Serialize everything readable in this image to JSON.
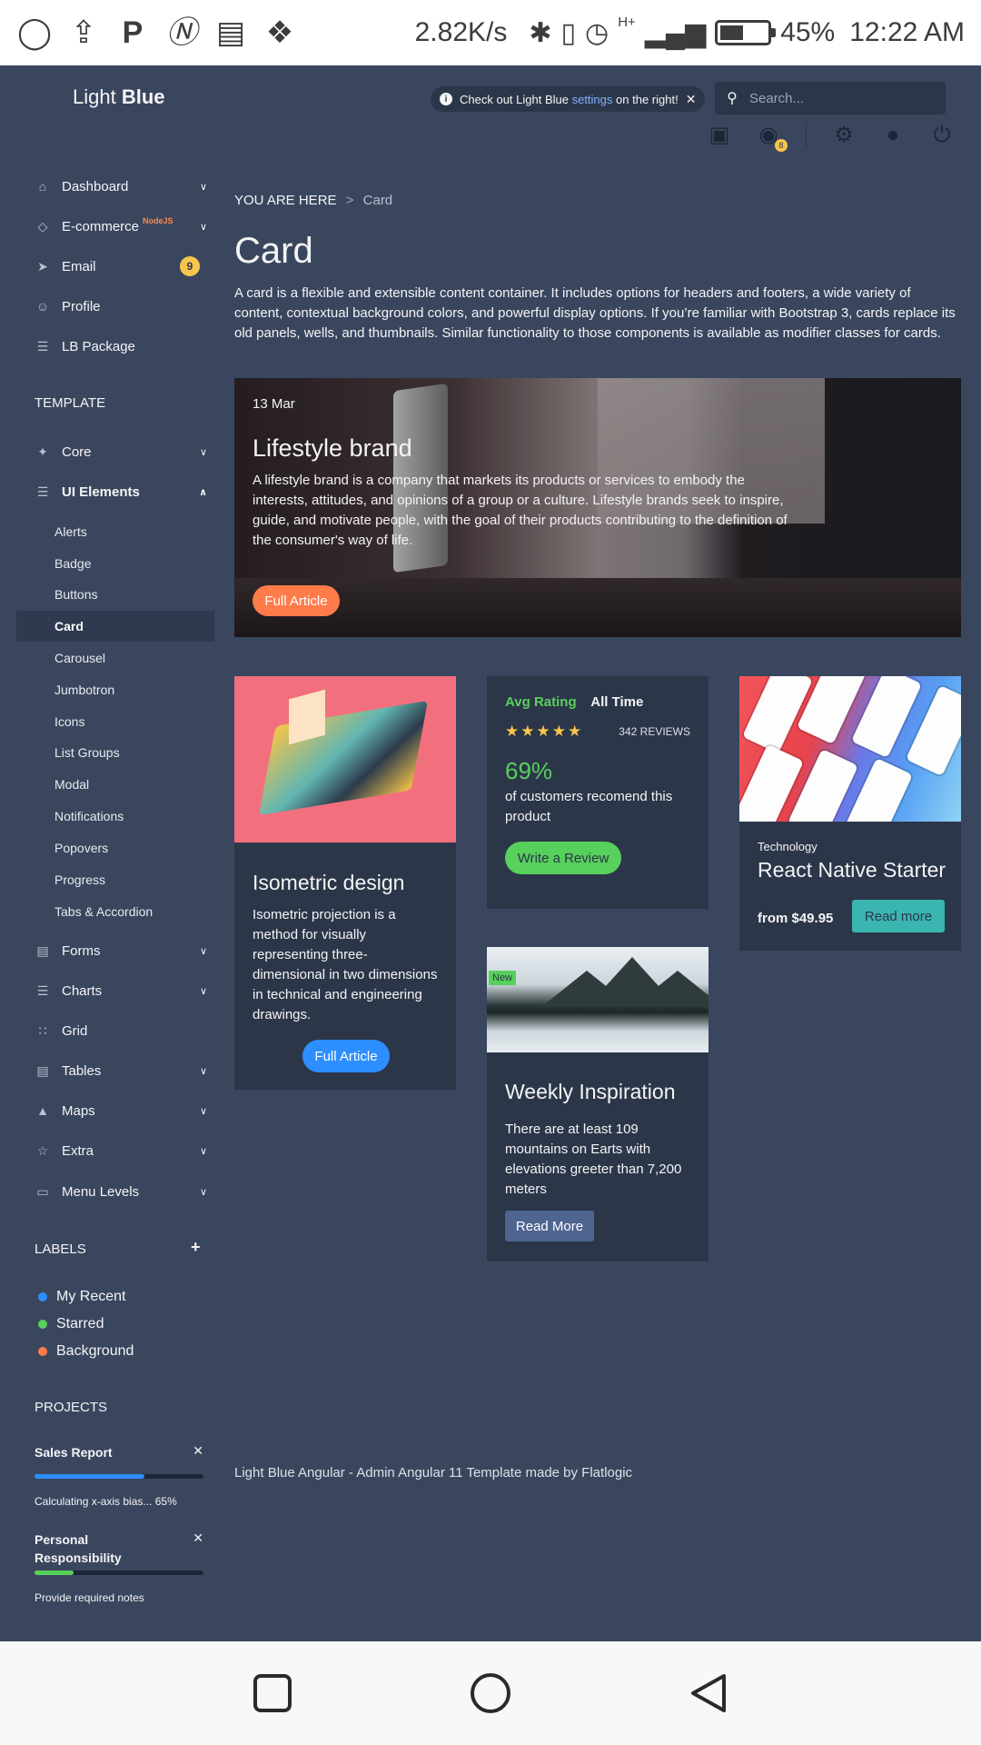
{
  "statusbar": {
    "net_speed": "2.82K/s",
    "network": "H+",
    "battery": "45%",
    "battery_level": 0.45,
    "time": "12:22 AM"
  },
  "navbar": {
    "logo_light": "Light",
    "logo_bold": "Blue",
    "notice_prefix": "Check out Light Blue",
    "notice_link": "settings",
    "notice_suffix": "on the right!",
    "search_placeholder": "Search...",
    "notif_count": "8"
  },
  "sidebar": {
    "items": [
      {
        "label": "Dashboard"
      },
      {
        "label": "E-commerce",
        "sup": "NodeJS"
      },
      {
        "label": "Email",
        "badge": "9"
      },
      {
        "label": "Profile"
      },
      {
        "label": "LB Package"
      }
    ],
    "template_heading": "TEMPLATE",
    "template_items": [
      {
        "label": "Core"
      },
      {
        "label": "UI Elements"
      }
    ],
    "ui_sub": [
      "Alerts",
      "Badge",
      "Buttons",
      "Card",
      "Carousel",
      "Jumbotron",
      "Icons",
      "List Groups",
      "Modal",
      "Notifications",
      "Popovers",
      "Progress",
      "Tabs & Accordion"
    ],
    "more_items": [
      {
        "label": "Forms"
      },
      {
        "label": "Charts"
      },
      {
        "label": "Grid"
      },
      {
        "label": "Tables"
      },
      {
        "label": "Maps"
      },
      {
        "label": "Extra"
      },
      {
        "label": "Menu Levels"
      }
    ],
    "labels_heading": "LABELS",
    "labels": [
      {
        "label": "My Recent",
        "color": "#2d8eff"
      },
      {
        "label": "Starred",
        "color": "#57d05c"
      },
      {
        "label": "Background",
        "color": "#ff7b49"
      }
    ],
    "projects_heading": "PROJECTS",
    "projects": [
      {
        "title": "Sales Report",
        "progress": 0.65,
        "color": "#2d8eff",
        "note": "Calculating x-axis bias... 65%"
      },
      {
        "title": "Personal Responsibility",
        "progress": 0.23,
        "color": "#57d05c",
        "note": "Provide required notes"
      }
    ]
  },
  "main": {
    "breadcrumb_root": "YOU ARE HERE",
    "breadcrumb_sep": ">",
    "breadcrumb_current": "Card",
    "title": "Card",
    "description": "A card is a flexible and extensible content container. It includes options for headers and footers, a wide variety of content, contextual background colors, and powerful display options. If you’re familiar with Bootstrap 3, cards replace its old panels, wells, and thumbnails. Similar functionality to those components is available as modifier classes for cards.",
    "hero": {
      "date": "13 Mar",
      "title": "Lifestyle brand",
      "text": "A lifestyle brand is a company that markets its products or services to embody the interests, attitudes, and opinions of a group or a culture. Lifestyle brands seek to inspire, guide, and motivate people, with the goal of their products contributing to the definition of the consumer's way of life.",
      "button": "Full Article"
    },
    "iso_card": {
      "title": "Isometric design",
      "text": "Isometric projection is a method for visually representing three-dimensional in two dimensions in technical and engineering drawings.",
      "button": "Full Article"
    },
    "rating_card": {
      "label": "Avg Rating",
      "period": "All Time",
      "stars": "★★★★★",
      "rating": 5,
      "reviews": "342 REVIEWS",
      "percent": "69%",
      "text": "of customers recomend this product",
      "button": "Write a Review"
    },
    "react_card": {
      "category": "Technology",
      "title": "React Native Starter",
      "price": "from $49.95",
      "button": "Read more"
    },
    "weekly_card": {
      "tag": "New",
      "title": "Weekly Inspiration",
      "text": "There are at least 109 mountains on Earts with elevations greeter than 7,200 meters",
      "button": "Read More"
    },
    "footer": "Light Blue Angular - Admin Angular 11 Template made by Flatlogic"
  }
}
